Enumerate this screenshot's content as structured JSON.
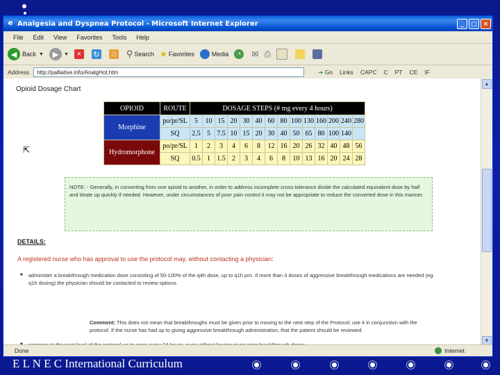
{
  "window": {
    "title": "Analgesia and Dyspnea Protocol - Microsoft Internet Explorer",
    "menu": [
      "File",
      "Edit",
      "View",
      "Favorites",
      "Tools",
      "Help"
    ],
    "toolbar": {
      "back": "Back",
      "search": "Search",
      "favorites": "Favorites",
      "media": "Media"
    },
    "address_label": "Address",
    "address_value": "http://palliative.info/AnalgHot.htm",
    "go_label": "Go",
    "links_label": "Links",
    "links": [
      "CAPC",
      "C",
      "PT",
      "CE",
      "IF"
    ],
    "status_done": "Done",
    "status_zone": "Internet"
  },
  "page": {
    "chart_title": "Opioid Dosage Chart",
    "table": {
      "headers": {
        "opioid": "OPIOID",
        "route": "ROUTE",
        "steps": "DOSAGE STEPS (# mg every 4 hours)"
      },
      "morphine": {
        "name": "Morphine",
        "rows": [
          {
            "route": "po/pr/SL",
            "values": [
              "5",
              "10",
              "15",
              "20",
              "30",
              "40",
              "60",
              "80",
              "100",
              "130",
              "160",
              "200",
              "240",
              "280"
            ]
          },
          {
            "route": "SQ",
            "values": [
              "2.5",
              "5",
              "7.5",
              "10",
              "15",
              "20",
              "30",
              "40",
              "50",
              "65",
              "80",
              "100",
              "140",
              ""
            ]
          }
        ]
      },
      "hydromorphone": {
        "name": "Hydromorphone",
        "rows": [
          {
            "route": "po/pr/SL",
            "values": [
              "1",
              "2",
              "3",
              "4",
              "6",
              "8",
              "12",
              "16",
              "20",
              "26",
              "32",
              "40",
              "48",
              "56"
            ]
          },
          {
            "route": "SQ",
            "values": [
              "0.5",
              "1",
              "1.5",
              "2",
              "3",
              "4",
              "6",
              "8",
              "10",
              "13",
              "16",
              "20",
              "24",
              "28"
            ]
          }
        ]
      }
    },
    "note": "NOTE: - Generally, in converting from one opioid to another, in order to address incomplete cross-tolerance divide the calculated equivalent dose by half and titrate up quickly if needed. However, under circumstances of poor pain control it may not be appropriate to reduce the converted dose in this manner.",
    "details_title": "DETAILS:",
    "rn_line_red": "A registered nurse who has approval to use the protocol may, without contacting a physician",
    "rn_line_tail": ":",
    "bullet1": "administer a breakthrough medication dose consisting of 50-100% of the q4h dose, up to q1h prn. If more than 3 doses of aggressive breakthrough medications are needed (eg. q1h dosing) the physician should be contacted to review options.",
    "comment_label": "Comment:",
    "comment_text": "This does not mean that breakthroughs must be given prior to moving to the next step of the Protocol; use it in conjunction with the protocol. If the nurse has had up to giving aggressive breakthrough administration, that the patient should be reviewed.",
    "bullet2": "progress to the next level of the protocol up to once every 24 hours, even without having given prior breakthrough doses"
  },
  "slide": {
    "footer": "E L N E C International Curriculum"
  },
  "colors": {
    "slide_bg": "#0b1fa8",
    "morphine_cell": "#c9e5f6",
    "hydromorphone_cell": "#fdf6b8",
    "morphine_label": "#1b3cb0",
    "hydromorphone_label": "#7a0a0a",
    "note_bg": "#e5f7df"
  }
}
